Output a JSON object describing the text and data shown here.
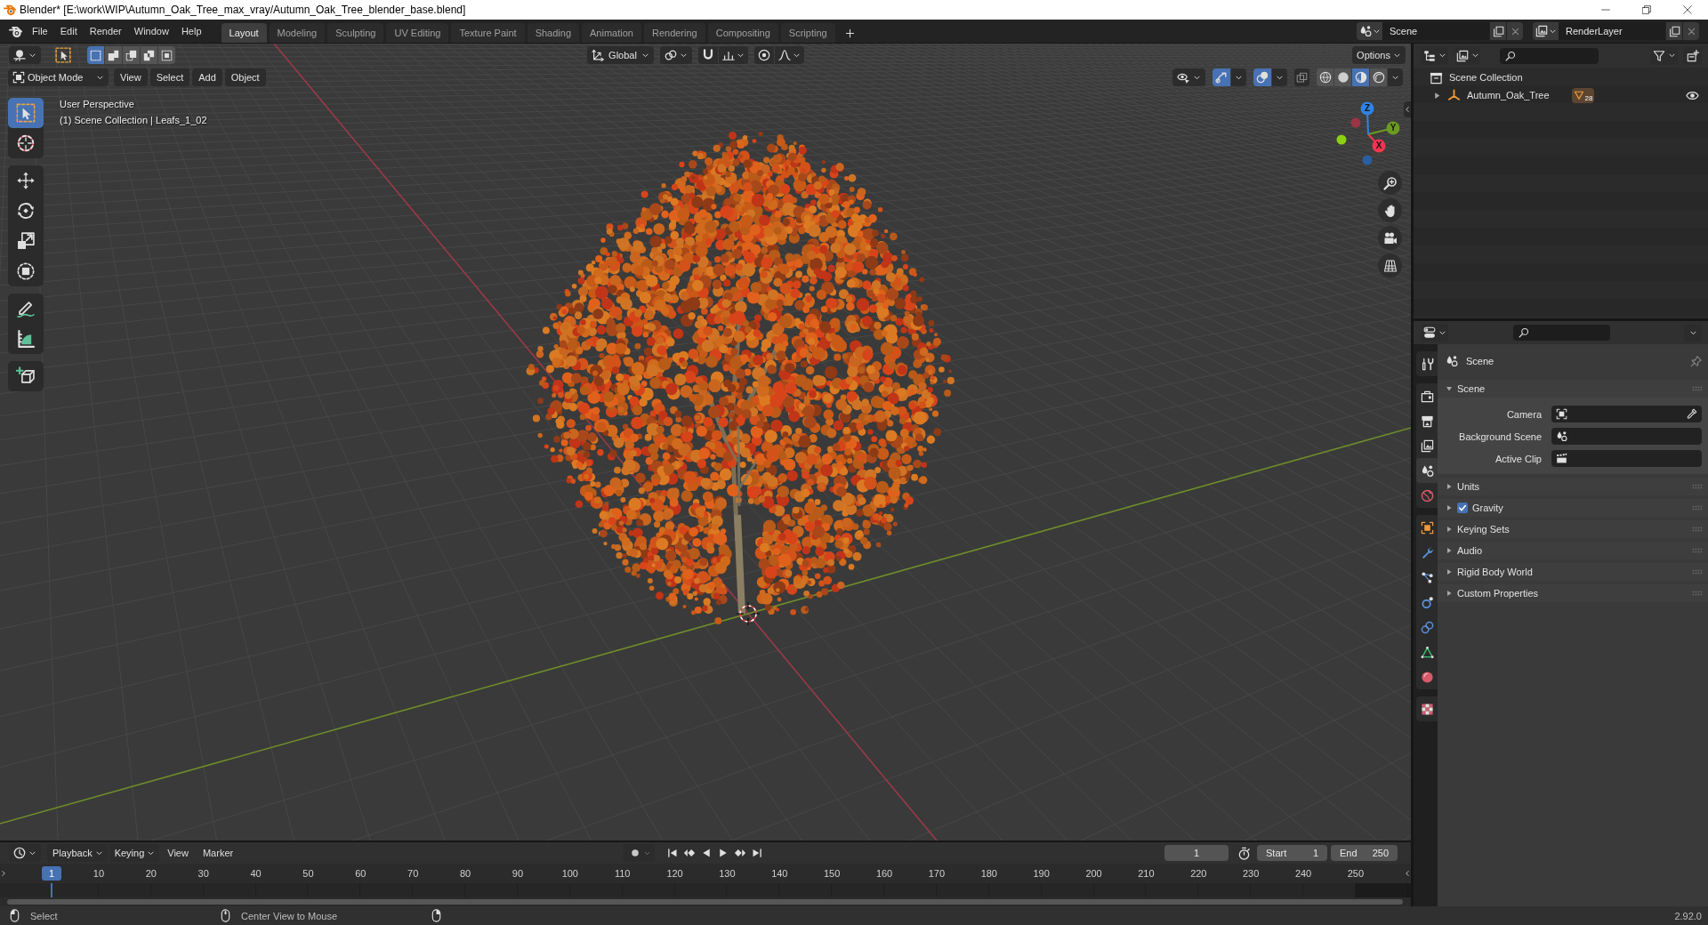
{
  "window": {
    "title": "Blender* [E:\\work\\WIP\\Autumn_Oak_Tree_max_vray/Autumn_Oak_Tree_blender_base.blend]"
  },
  "menu_bar": [
    "File",
    "Edit",
    "Render",
    "Window",
    "Help"
  ],
  "workspace_tabs": [
    {
      "label": "Layout",
      "selected": true
    },
    {
      "label": "Modeling",
      "selected": false
    },
    {
      "label": "Sculpting",
      "selected": false
    },
    {
      "label": "UV Editing",
      "selected": false
    },
    {
      "label": "Texture Paint",
      "selected": false
    },
    {
      "label": "Shading",
      "selected": false
    },
    {
      "label": "Animation",
      "selected": false
    },
    {
      "label": "Rendering",
      "selected": false
    },
    {
      "label": "Compositing",
      "selected": false
    },
    {
      "label": "Scripting",
      "selected": false
    }
  ],
  "scene": {
    "value": "Scene"
  },
  "view_layer": {
    "value": "RenderLayer"
  },
  "viewport": {
    "select_modes": [
      {
        "kind": "set",
        "selected": true
      },
      {
        "kind": "extend",
        "selected": false
      },
      {
        "kind": "subtract",
        "selected": false
      },
      {
        "kind": "difference",
        "selected": false
      },
      {
        "kind": "intersect",
        "selected": false
      }
    ],
    "orientation": "Global",
    "options": "Options",
    "mode": "Object Mode",
    "menus": [
      "View",
      "Select",
      "Add",
      "Object"
    ],
    "gizmos_on": true,
    "overlays_on": true,
    "xray_on": false,
    "shading_modes": [
      {
        "kind": "wireframe",
        "selected": false
      },
      {
        "kind": "solid",
        "selected": false
      },
      {
        "kind": "material",
        "selected": true
      },
      {
        "kind": "rendered",
        "selected": false
      }
    ],
    "tool_groups": [
      [
        {
          "kind": "select_box",
          "selected": true
        },
        {
          "kind": "cursor",
          "selected": false
        }
      ],
      [
        {
          "kind": "move",
          "selected": false
        },
        {
          "kind": "rotate",
          "selected": false
        },
        {
          "kind": "scale",
          "selected": false
        },
        {
          "kind": "transform",
          "selected": false
        }
      ],
      [
        {
          "kind": "annotate",
          "selected": false
        },
        {
          "kind": "measure",
          "selected": false
        }
      ],
      [
        {
          "kind": "add_cube",
          "selected": false
        }
      ]
    ],
    "info": [
      "User Perspective",
      "(1) Scene Collection | Leafs_1_02"
    ],
    "axes": [
      {
        "label": "X",
        "color": "#f0364f"
      },
      {
        "label": "Y",
        "color": "#6c9a21"
      },
      {
        "label": "Z",
        "color": "#2d83e6"
      }
    ],
    "negative_axes": [
      {
        "color": "#9b3445"
      },
      {
        "color": "#8bd012"
      },
      {
        "color": "#2b5e9f"
      }
    ]
  },
  "timeline": {
    "menus": [
      {
        "label": "Playback",
        "kind": "dropdown"
      },
      {
        "label": "Keying",
        "kind": "dropdown"
      },
      {
        "label": "View",
        "kind": "plain"
      },
      {
        "label": "Marker",
        "kind": "plain"
      }
    ],
    "current_frame": "1",
    "start_label": "Start",
    "start": "1",
    "end_label": "End",
    "end": "250",
    "playhead": "1",
    "ruler": [
      "10",
      "20",
      "30",
      "40",
      "50",
      "60",
      "70",
      "80",
      "90",
      "100",
      "110",
      "120",
      "130",
      "140",
      "150",
      "160",
      "170",
      "180",
      "190",
      "200",
      "210",
      "220",
      "230",
      "240",
      "250"
    ]
  },
  "outliner": {
    "items": [
      {
        "label": "Scene Collection",
        "kind": "collection",
        "children": [
          {
            "label": "Autumn_Oak_Tree",
            "kind": "empty",
            "expanded": false,
            "data_badge": "28",
            "visible": true
          }
        ]
      }
    ]
  },
  "properties": {
    "tab_groups": [
      [
        {
          "kind": "tool",
          "selected": false
        }
      ],
      [
        {
          "kind": "render",
          "selected": false
        },
        {
          "kind": "output",
          "selected": false
        },
        {
          "kind": "view_layer",
          "selected": false
        },
        {
          "kind": "scene",
          "selected": true
        },
        {
          "kind": "world",
          "selected": false
        }
      ],
      [
        {
          "kind": "object",
          "selected": false
        },
        {
          "kind": "modifiers",
          "selected": false
        },
        {
          "kind": "particles",
          "selected": false
        },
        {
          "kind": "physics",
          "selected": false
        },
        {
          "kind": "constraints",
          "selected": false
        },
        {
          "kind": "data",
          "selected": false
        },
        {
          "kind": "material",
          "selected": false
        }
      ],
      [
        {
          "kind": "texture",
          "selected": false
        }
      ]
    ],
    "context": "Scene",
    "panels": [
      {
        "label": "Scene",
        "kind": "plain",
        "expanded": true,
        "fields": [
          {
            "label": "Camera",
            "kind": "object"
          },
          {
            "label": "Background Scene",
            "kind": "scene"
          },
          {
            "label": "Active Clip",
            "kind": "clip"
          }
        ]
      },
      {
        "label": "Units",
        "kind": "plain",
        "expanded": false
      },
      {
        "label": "Gravity",
        "kind": "toggle",
        "expanded": false,
        "checked": true
      },
      {
        "label": "Keying Sets",
        "kind": "plain",
        "expanded": false
      },
      {
        "label": "Audio",
        "kind": "plain",
        "expanded": false
      },
      {
        "label": "Rigid Body World",
        "kind": "plain",
        "expanded": false
      },
      {
        "label": "Custom Properties",
        "kind": "plain",
        "expanded": false
      }
    ]
  },
  "status_bar": {
    "hints": [
      {
        "kind": "left_click",
        "label": "Select"
      },
      {
        "kind": "middle_click",
        "label": "Center View to Mouse"
      },
      {
        "kind": "right_click"
      }
    ],
    "version": "2.92.0"
  }
}
